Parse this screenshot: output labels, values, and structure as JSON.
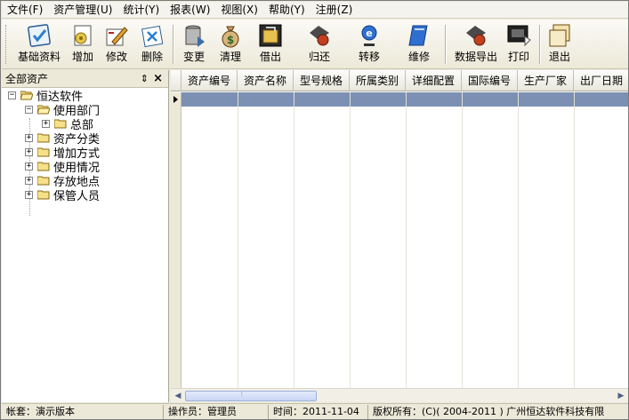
{
  "menu": [
    {
      "label": "文件(F)"
    },
    {
      "label": "资产管理(U)"
    },
    {
      "label": "统计(Y)"
    },
    {
      "label": "报表(W)"
    },
    {
      "label": "视图(X)"
    },
    {
      "label": "帮助(Y)"
    },
    {
      "label": "注册(Z)"
    }
  ],
  "toolbar": {
    "buttons": [
      {
        "label": "基础资料",
        "icon": "check-doc-icon"
      },
      {
        "label": "增加",
        "icon": "add-gear-icon"
      },
      {
        "label": "修改",
        "icon": "edit-pencil-icon"
      },
      {
        "label": "删除",
        "icon": "delete-x-icon"
      },
      {
        "label": "变更",
        "icon": "change-can-icon"
      },
      {
        "label": "清理",
        "icon": "money-bag-icon"
      },
      {
        "label": "借出",
        "icon": "lend-box-icon"
      },
      {
        "label": "归还",
        "icon": "return-arrow-icon"
      },
      {
        "label": "转移",
        "icon": "transfer-e-icon"
      },
      {
        "label": "维修",
        "icon": "repair-book-icon"
      },
      {
        "label": "数据导出",
        "icon": "export-arrow-icon"
      },
      {
        "label": "打印",
        "icon": "printer-icon"
      },
      {
        "label": "退出",
        "icon": "exit-frames-icon"
      }
    ]
  },
  "left_panel": {
    "title": "全部资产",
    "pin_icon": "⇕",
    "close_icon": "×",
    "tree": {
      "root": "恒达软件",
      "dept": "使用部门",
      "dept_child": "总部",
      "items": [
        "资产分类",
        "增加方式",
        "使用情况",
        "存放地点",
        "保管人员"
      ]
    }
  },
  "grid": {
    "columns": [
      "资产编号",
      "资产名称",
      "型号规格",
      "所属类别",
      "详细配置",
      "国际编号",
      "生产厂家",
      "出厂日期"
    ]
  },
  "status": {
    "account": "帐套：演示版本",
    "operator": "操作员：管理员",
    "time": "时间：2011-11-04",
    "copyright": "版权所有：(C)( 2004-2011 ) 广州恒达软件科技有限"
  },
  "colors": {
    "selection": "#7b90b2",
    "window_bg": "#ece9d8"
  }
}
